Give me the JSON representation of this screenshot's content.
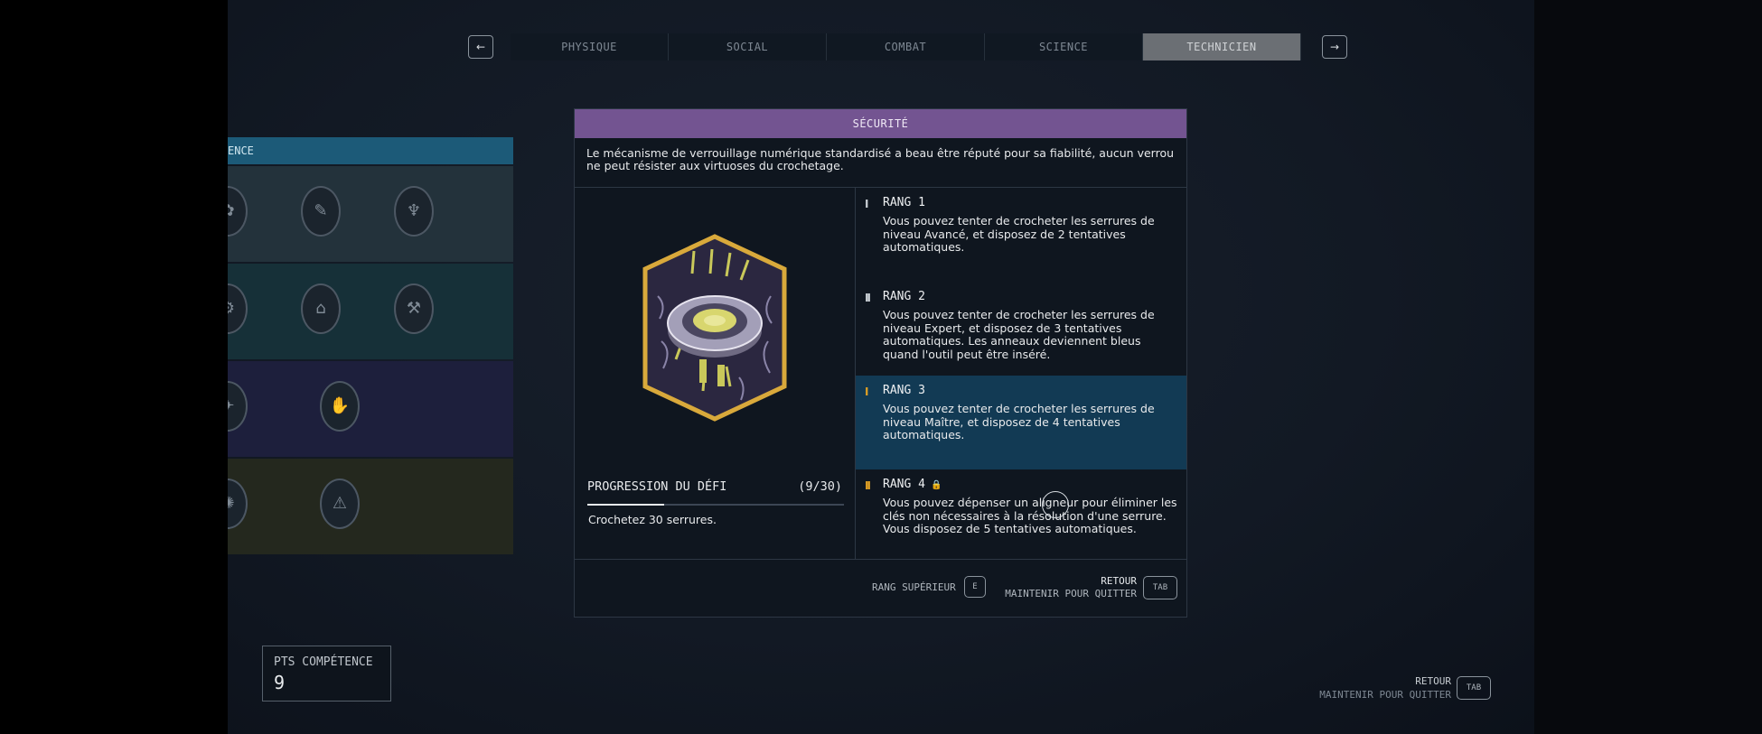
{
  "nav": {
    "prev_arrow": "←",
    "next_arrow": "→",
    "tabs": [
      {
        "label": "PHYSIQUE",
        "active": false
      },
      {
        "label": "SOCIAL",
        "active": false
      },
      {
        "label": "COMBAT",
        "active": false
      },
      {
        "label": "SCIENCE",
        "active": false
      },
      {
        "label": "TECHNICIEN",
        "active": true
      }
    ]
  },
  "skill_panel": {
    "header": "ENCE",
    "row_colors": [
      "#23323b",
      "#163038",
      "#1d1f3c",
      "#24281e"
    ]
  },
  "skill_card": {
    "title": "SÉCURITÉ",
    "description": "Le mécanisme de verrouillage numérique standardisé a beau être réputé pour sa fiabilité, aucun verrou ne peut résister aux virtuoses du crochetage.",
    "challenge": {
      "title": "PROGRESSION DU DÉFI",
      "count": "(9/30)",
      "progress": 0.3,
      "description": "Crochetez 30 serrures."
    },
    "ranks": [
      {
        "mark": "I",
        "title": "RANG 1",
        "text": "Vous pouvez tenter de crocheter les serrures de niveau Avancé, et disposez de 2 tentatives automatiques.",
        "state": "unlocked"
      },
      {
        "mark": "II",
        "title": "RANG 2",
        "text": "Vous pouvez tenter de crocheter les serrures de niveau Expert, et disposez de 3 tentatives automatiques. Les anneaux deviennent bleus quand l'outil peut être inséré.",
        "state": "unlocked"
      },
      {
        "mark": "I",
        "title": "RANG 3",
        "text": "Vous pouvez tenter de crocheter les serrures de niveau Maître, et disposez de 4 tentatives automatiques.",
        "state": "current"
      },
      {
        "mark": "II",
        "title": "RANG 4",
        "text": "Vous pouvez dépenser un aligneur pour éliminer les clés non nécessaires à la résolution d'une serrure. Vous disposez de 5 tentatives automatiques.",
        "state": "locked"
      }
    ],
    "footer": {
      "rank_up_label": "RANG SUPÉRIEUR",
      "rank_up_key": "E",
      "back_label": "RETOUR",
      "hold_label": "MAINTENIR POUR QUITTER",
      "back_key": "TAB"
    }
  },
  "skill_points": {
    "label": "PTS COMPÉTENCE",
    "value": "9"
  },
  "bottom_right": {
    "back_label": "RETOUR",
    "hold_label": "MAINTENIR POUR QUITTER",
    "key": "TAB"
  },
  "colors": {
    "card_title": "#735491",
    "current_rank": "#123a54",
    "rank_gold": "#e0a024",
    "active_tab": "#6b6f74"
  }
}
